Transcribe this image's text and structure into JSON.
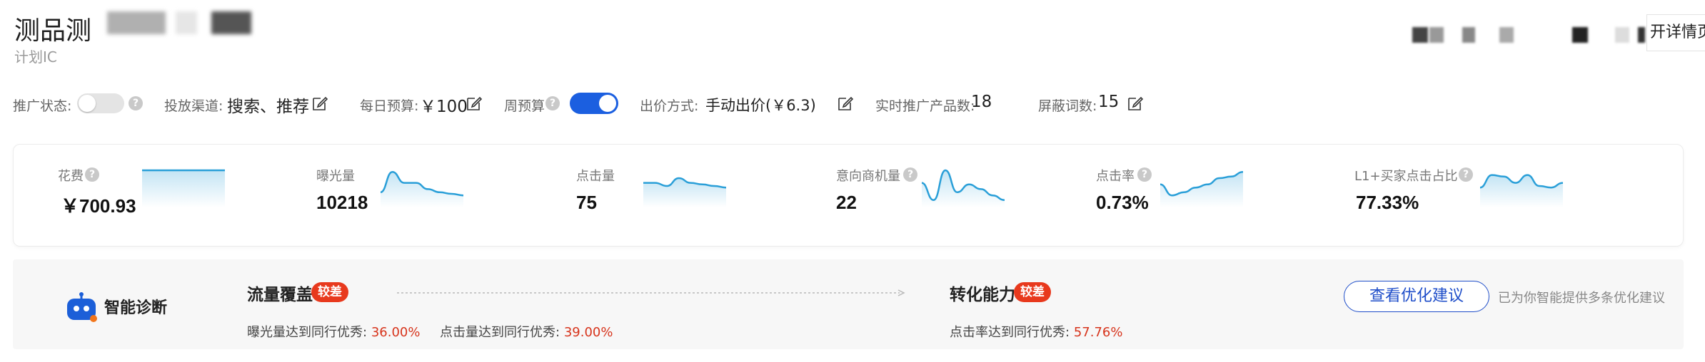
{
  "header": {
    "title": "测品测",
    "subtitle": "计划IC",
    "detail_button": "开详情页"
  },
  "controls": {
    "status_label": "推广状态:",
    "channel_label": "投放渠道:",
    "channel_value": "搜索、推荐",
    "daily_budget_label": "每日预算:",
    "daily_budget_value": "￥100",
    "weekly_budget_label": "周预算",
    "bid_label": "出价方式:",
    "bid_value": "手动出价(￥6.3)",
    "realtime_products_label": "实时推广产品数:",
    "realtime_products_value": "18",
    "blocked_words_label": "屏蔽词数:",
    "blocked_words_value": "15",
    "status_on": false,
    "weekly_budget_on": true
  },
  "metrics": [
    {
      "label": "花费",
      "value": "￥700.93",
      "trend": [
        1,
        1,
        1,
        1,
        1,
        1,
        1,
        1
      ]
    },
    {
      "label": "曝光量",
      "value": "10218",
      "trend": [
        0.3,
        0.95,
        0.6,
        0.6,
        0.4,
        0.3,
        0.25,
        0.2
      ]
    },
    {
      "label": "点击量",
      "value": "75",
      "trend": [
        0.6,
        0.6,
        0.5,
        0.75,
        0.6,
        0.55,
        0.5,
        0.45
      ]
    },
    {
      "label": "意向商机量",
      "value": "22",
      "trend": [
        0.6,
        0.05,
        1.0,
        0.3,
        0.55,
        0.4,
        0.2,
        0.05
      ]
    },
    {
      "label": "点击率",
      "value": "0.73%",
      "trend": [
        0.55,
        0.2,
        0.3,
        0.45,
        0.55,
        0.75,
        0.8,
        0.95
      ]
    },
    {
      "label": "L1+买家点击占比",
      "value": "77.33%",
      "trend": [
        0.45,
        0.85,
        0.8,
        0.6,
        0.85,
        0.5,
        0.45,
        0.6
      ]
    }
  ],
  "diagnosis": {
    "title": "智能诊断",
    "traffic": {
      "title": "流量覆盖",
      "badge": "较差",
      "exposure_text": "曝光量达到同行优秀:",
      "exposure_value": "36.00%",
      "click_text": "点击量达到同行优秀:",
      "click_value": "39.00%"
    },
    "conversion": {
      "title": "转化能力",
      "badge": "较差",
      "ctr_text": "点击率达到同行优秀:",
      "ctr_value": "57.76%"
    },
    "suggest_button": "查看优化建议",
    "suggest_note": "已为你智能提供多条优化建议"
  },
  "colors": {
    "accent": "#1b5fe0",
    "spark_line": "#2a9fd8",
    "badge": "#e8391d",
    "good_value": "#d7341c"
  }
}
